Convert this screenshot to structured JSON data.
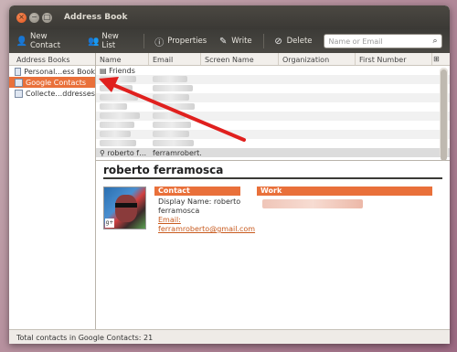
{
  "window": {
    "title": "Address Book"
  },
  "toolbar": {
    "new_contact": "New Contact",
    "new_list": "New List",
    "properties": "Properties",
    "write": "Write",
    "delete": "Delete",
    "search_placeholder": "Name or Email"
  },
  "sidebar": {
    "header": "Address Books",
    "items": [
      {
        "label": "Personal…ess Book"
      },
      {
        "label": "Google Contacts"
      },
      {
        "label": "Collecte…ddresses"
      }
    ]
  },
  "list": {
    "columns": [
      "Name",
      "Email",
      "Screen Name",
      "Organization",
      "First Number"
    ],
    "first_row": "Friends",
    "selected_row": {
      "name": "roberto f…",
      "email": "ferramrobert…"
    }
  },
  "detail": {
    "name": "roberto ferramosca",
    "contact_header": "Contact",
    "work_header": "Work",
    "display_name_line1": "Display Name: roberto",
    "display_name_line2": "ferramosca",
    "email_label": "Email:",
    "email_value": "ferramroberto@gmail.com"
  },
  "status": {
    "text": "Total contacts in Google Contacts: 21"
  },
  "colors": {
    "accent": "#e9703a",
    "annotation_arrow": "#e0201e"
  }
}
